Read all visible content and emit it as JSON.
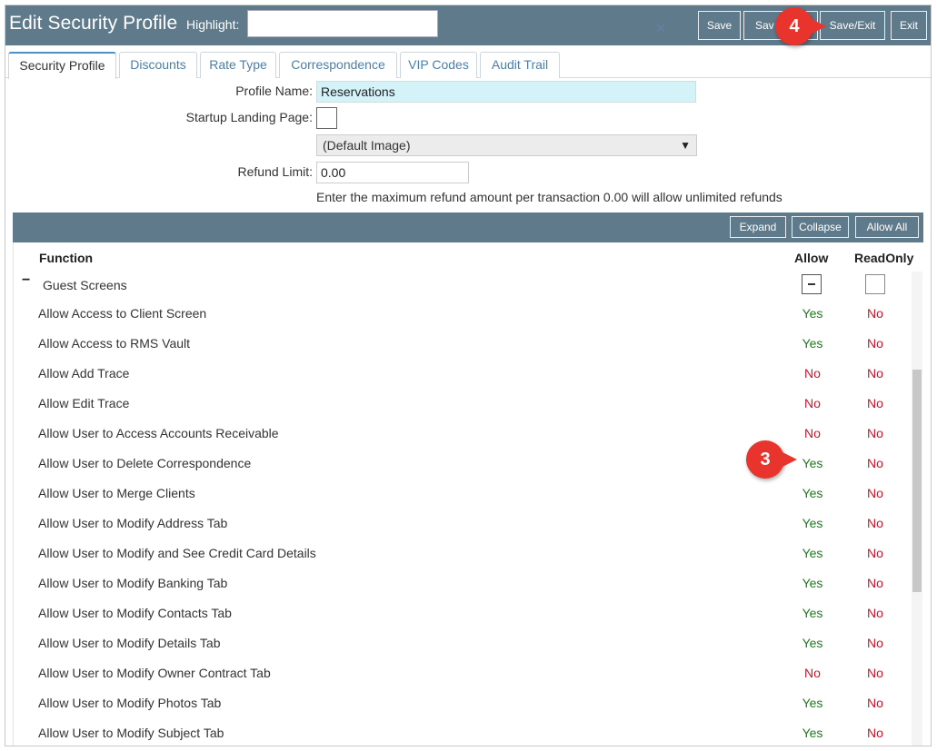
{
  "header": {
    "title": "Edit Security Profile",
    "highlight_label": "Highlight:",
    "highlight_value": "",
    "clear_glyph": "×",
    "buttons": {
      "save": "Save",
      "save_as": "Sav",
      "save_exit": "Save/Exit",
      "exit": "Exit"
    }
  },
  "annotations": {
    "badge_4": "4",
    "badge_3": "3",
    "color": "#e8342c"
  },
  "tabs": [
    {
      "label": "Security Profile",
      "active": true
    },
    {
      "label": "Discounts",
      "active": false
    },
    {
      "label": "Rate Type",
      "active": false
    },
    {
      "label": "Correspondence",
      "active": false
    },
    {
      "label": "VIP Codes",
      "active": false
    },
    {
      "label": "Audit Trail",
      "active": false
    }
  ],
  "form": {
    "profile_name_label": "Profile Name:",
    "profile_name_value": "Reservations",
    "startup_label": "Startup Landing Page:",
    "image_select_value": "(Default Image)",
    "refund_label": "Refund Limit:",
    "refund_value": "0.00",
    "refund_hint": "Enter the maximum refund amount per transaction 0.00 will allow unlimited refunds"
  },
  "grid_toolbar": {
    "expand": "Expand",
    "collapse": "Collapse",
    "allow_all": "Allow All"
  },
  "grid": {
    "col_function": "Function",
    "col_allow": "Allow",
    "col_readonly": "ReadOnly",
    "group_toggle": "−",
    "group_label": "Guest Screens",
    "rows": [
      {
        "function": "Allow Access to Client Screen",
        "allow": "Yes",
        "readonly": "No"
      },
      {
        "function": "Allow Access to RMS Vault",
        "allow": "Yes",
        "readonly": "No"
      },
      {
        "function": "Allow Add Trace",
        "allow": "No",
        "readonly": "No"
      },
      {
        "function": "Allow Edit Trace",
        "allow": "No",
        "readonly": "No"
      },
      {
        "function": "Allow User to Access Accounts Receivable",
        "allow": "No",
        "readonly": "No"
      },
      {
        "function": "Allow User to Delete Correspondence",
        "allow": "Yes",
        "readonly": "No"
      },
      {
        "function": "Allow User to Merge Clients",
        "allow": "Yes",
        "readonly": "No"
      },
      {
        "function": "Allow User to Modify Address Tab",
        "allow": "Yes",
        "readonly": "No"
      },
      {
        "function": "Allow User to Modify and See Credit Card Details",
        "allow": "Yes",
        "readonly": "No"
      },
      {
        "function": "Allow User to Modify Banking Tab",
        "allow": "Yes",
        "readonly": "No"
      },
      {
        "function": "Allow User to Modify Contacts Tab",
        "allow": "Yes",
        "readonly": "No"
      },
      {
        "function": "Allow User to Modify Details Tab",
        "allow": "Yes",
        "readonly": "No"
      },
      {
        "function": "Allow User to Modify Owner Contract Tab",
        "allow": "No",
        "readonly": "No"
      },
      {
        "function": "Allow User to Modify Photos Tab",
        "allow": "Yes",
        "readonly": "No"
      },
      {
        "function": "Allow User to Modify Subject Tab",
        "allow": "Yes",
        "readonly": "No"
      }
    ]
  },
  "colors": {
    "header_bg": "#5f7a8b",
    "yes": "#1f7a1f",
    "no": "#d1122a",
    "profile_name_bg": "#d4f3f8"
  }
}
